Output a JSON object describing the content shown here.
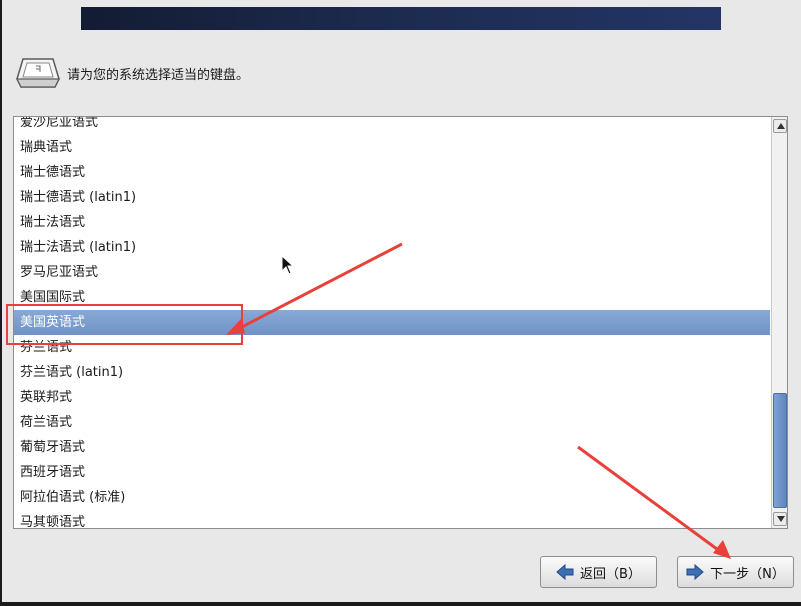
{
  "header": {
    "prompt": "请为您的系统选择适当的键盘。",
    "icon": "keyboard-icon"
  },
  "keyboard_list": {
    "items": [
      "爱沙尼亚语式",
      "瑞典语式",
      "瑞士德语式",
      "瑞士德语式 (latin1)",
      "瑞士法语式",
      "瑞士法语式 (latin1)",
      "罗马尼亚语式",
      "美国国际式",
      "美国英语式",
      "芬兰语式",
      "芬兰语式 (latin1)",
      "英联邦式",
      "荷兰语式",
      "葡萄牙语式",
      "西班牙语式",
      "阿拉伯语式 (标准)",
      "马其顿语式"
    ],
    "selected_index": 8,
    "scroll_position": 0.92
  },
  "buttons": {
    "back": {
      "label": "返回（B）",
      "icon": "arrow-left-icon"
    },
    "next": {
      "label": "下一步（N）",
      "icon": "arrow-right-icon"
    }
  },
  "colors": {
    "selection": "#7a9dce",
    "annotation": "#e8403a",
    "banner": "#1c2a4e"
  }
}
